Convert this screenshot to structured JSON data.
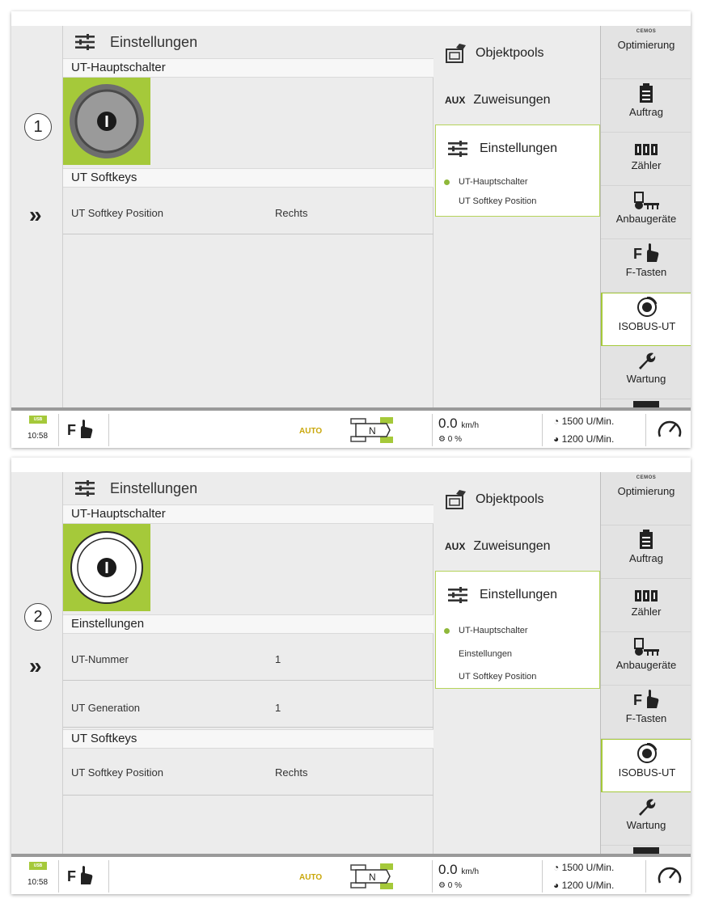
{
  "colors": {
    "accent": "#a5c93a",
    "panel_bg": "#ececec",
    "auto": "#c9a70a"
  },
  "common": {
    "expand_glyph": "»",
    "main_title": "Einstellungen",
    "mid": {
      "objectpools": "Objektpools",
      "aux_badge": "AUX",
      "assignments": "Zuweisungen",
      "settings": "Einstellungen"
    },
    "right": {
      "cemos_badge": "CEMOS",
      "items": [
        "Optimierung",
        "Auftrag",
        "Zähler",
        "Anbaugeräte",
        "F-Tasten",
        "ISOBUS-UT",
        "Wartung"
      ]
    },
    "status": {
      "usb": "USB",
      "time": "10:58",
      "f_label": "F",
      "auto": "AUTO",
      "gear": "N",
      "speed_value": "0.0",
      "speed_unit": "km/h",
      "slip": "0 %",
      "rpm1": "1500 U/Min.",
      "rpm2": "1200 U/Min."
    },
    "icons": [
      "sliders-icon",
      "objectpool-icon",
      "clipboard-icon",
      "counter-icon",
      "implement-icon",
      "f-hand-icon",
      "isobus-icon",
      "wrench-icon",
      "speedometer-icon",
      "tractor-icon"
    ]
  },
  "panel1": {
    "badge": "1",
    "sections": {
      "main_switch": "UT-Hauptschalter",
      "softkeys": "UT Softkeys"
    },
    "rows": [
      {
        "key": "UT Softkey Position",
        "value": "Rechts"
      }
    ],
    "sub_items": [
      "UT-Hauptschalter",
      "UT Softkey Position"
    ]
  },
  "panel2": {
    "badge": "2",
    "sections": {
      "main_switch": "UT-Hauptschalter",
      "settings": "Einstellungen",
      "softkeys": "UT Softkeys"
    },
    "rows": [
      {
        "key": "UT-Nummer",
        "value": "1"
      },
      {
        "key": "UT Generation",
        "value": "1"
      },
      {
        "key": "UT Softkey Position",
        "value": "Rechts"
      }
    ],
    "sub_items": [
      "UT-Hauptschalter",
      "Einstellungen",
      "UT Softkey Position"
    ]
  }
}
